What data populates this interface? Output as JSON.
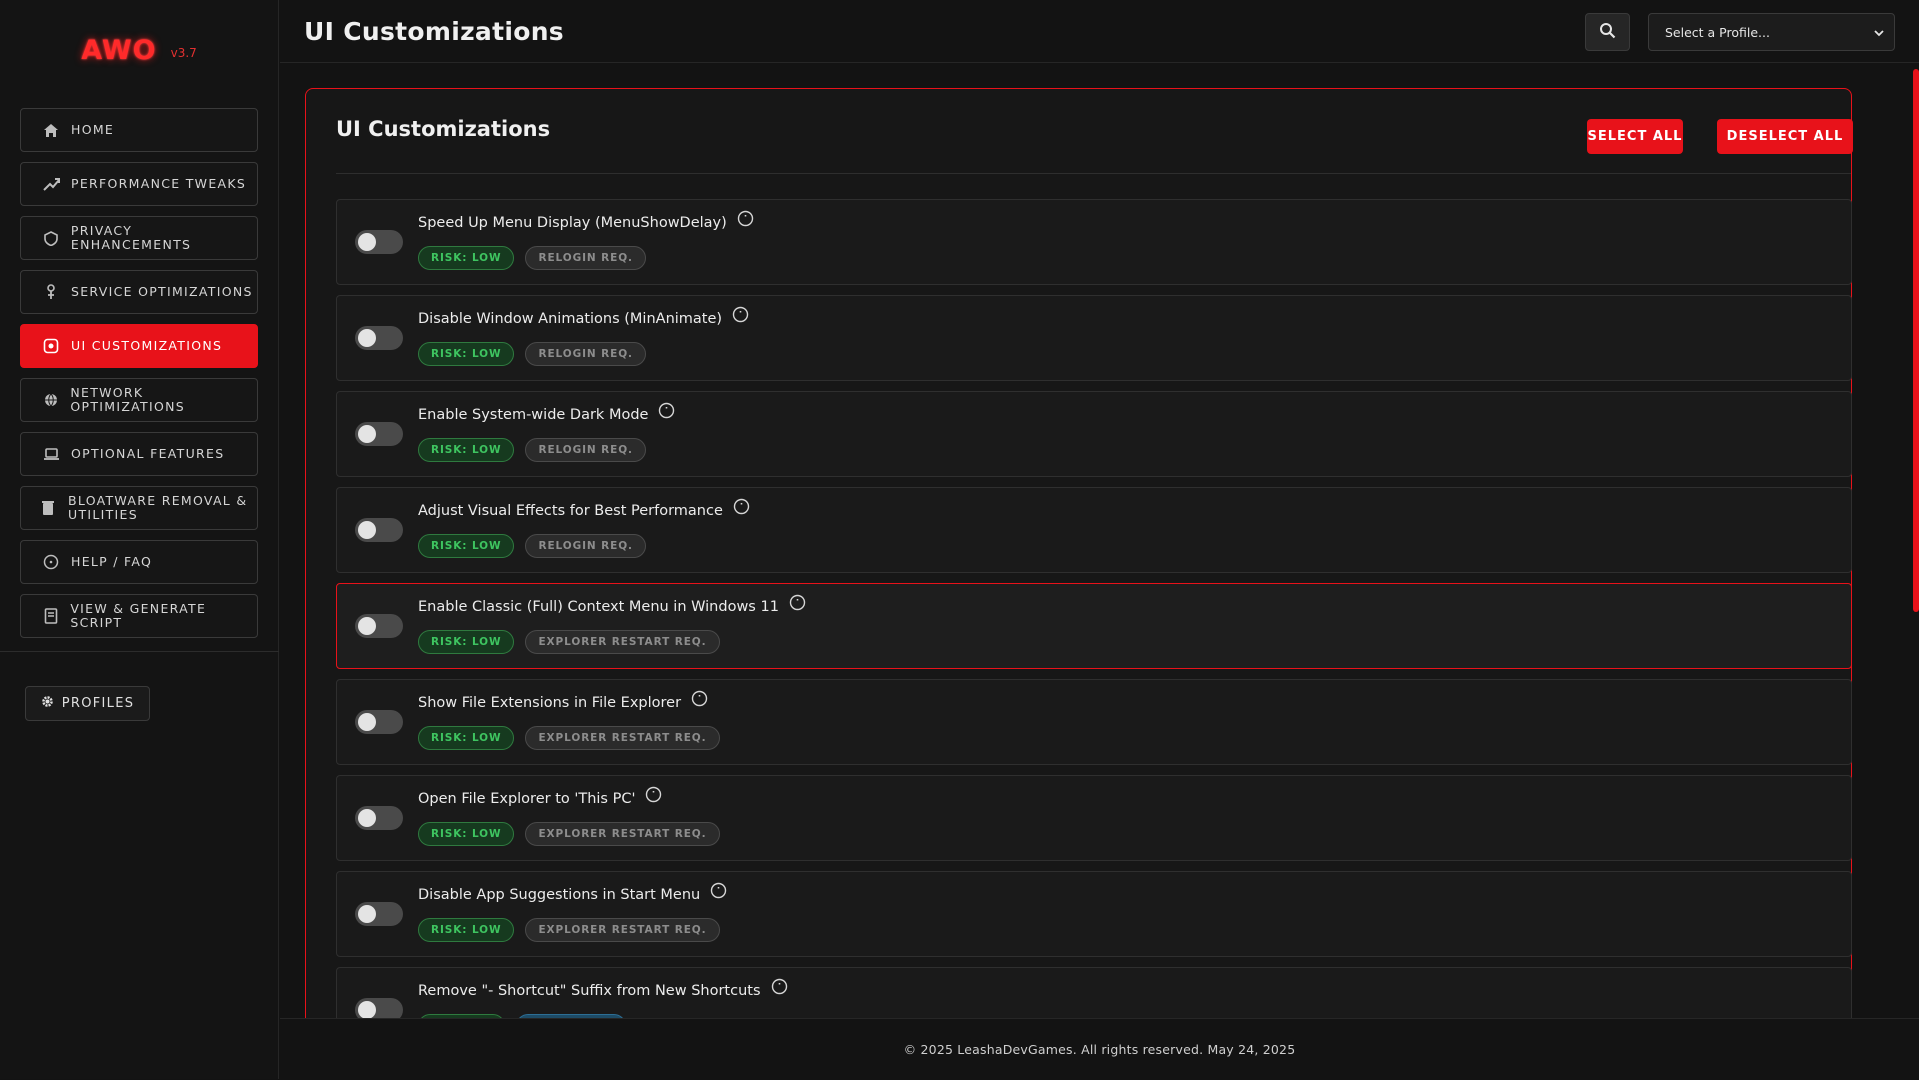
{
  "app": {
    "logo": "AWO",
    "version": "v3.7"
  },
  "colors": {
    "accent": "#e8121a",
    "risk_low": "#3ec460"
  },
  "sidebar": {
    "items": [
      {
        "label": "HOME",
        "icon": "home-icon"
      },
      {
        "label": "PERFORMANCE TWEAKS",
        "icon": "performance-icon"
      },
      {
        "label": "PRIVACY ENHANCEMENTS",
        "icon": "privacy-icon"
      },
      {
        "label": "SERVICE OPTIMIZATIONS",
        "icon": "service-icon"
      },
      {
        "label": "UI CUSTOMIZATIONS",
        "icon": "ui-icon",
        "active": true
      },
      {
        "label": "NETWORK OPTIMIZATIONS",
        "icon": "network-icon"
      },
      {
        "label": "OPTIONAL FEATURES",
        "icon": "laptop-icon"
      },
      {
        "label": "BLOATWARE REMOVAL & UTILITIES",
        "icon": "trash-icon"
      },
      {
        "label": "HELP / FAQ",
        "icon": "help-icon"
      },
      {
        "label": "VIEW & GENERATE SCRIPT",
        "icon": "script-icon"
      }
    ],
    "profiles_label": "PROFILES"
  },
  "header": {
    "title": "UI Customizations",
    "profile_select": "Select a Profile..."
  },
  "panel": {
    "title": "UI Customizations",
    "select_all": "SELECT ALL",
    "deselect_all": "DESELECT ALL"
  },
  "tweaks": [
    {
      "title": "Speed Up Menu Display (MenuShowDelay)",
      "risk": "RISK: LOW",
      "requirement": "RELOGIN REQ.",
      "enabled": false
    },
    {
      "title": "Disable Window Animations (MinAnimate)",
      "risk": "RISK: LOW",
      "requirement": "RELOGIN REQ.",
      "enabled": false
    },
    {
      "title": "Enable System-wide Dark Mode",
      "risk": "RISK: LOW",
      "requirement": "RELOGIN REQ.",
      "enabled": false
    },
    {
      "title": "Adjust Visual Effects for Best Performance",
      "risk": "RISK: LOW",
      "requirement": "RELOGIN REQ.",
      "enabled": false
    },
    {
      "title": "Enable Classic (Full) Context Menu in Windows 11",
      "risk": "RISK: LOW",
      "requirement": "EXPLORER RESTART REQ.",
      "enabled": false
    },
    {
      "title": "Show File Extensions in File Explorer",
      "risk": "RISK: LOW",
      "requirement": "EXPLORER RESTART REQ.",
      "enabled": false
    },
    {
      "title": "Open File Explorer to 'This PC'",
      "risk": "RISK: LOW",
      "requirement": "EXPLORER RESTART REQ.",
      "enabled": false
    },
    {
      "title": "Disable App Suggestions in Start Menu",
      "risk": "RISK: LOW",
      "requirement": "EXPLORER RESTART REQ.",
      "enabled": false
    },
    {
      "title": "Remove \"- Shortcut\" Suffix from New Shortcuts",
      "risk": "",
      "requirement": "",
      "enabled": false
    }
  ],
  "footer": {
    "text": "© 2025 LeashaDevGames. All rights reserved. May 24, 2025"
  }
}
